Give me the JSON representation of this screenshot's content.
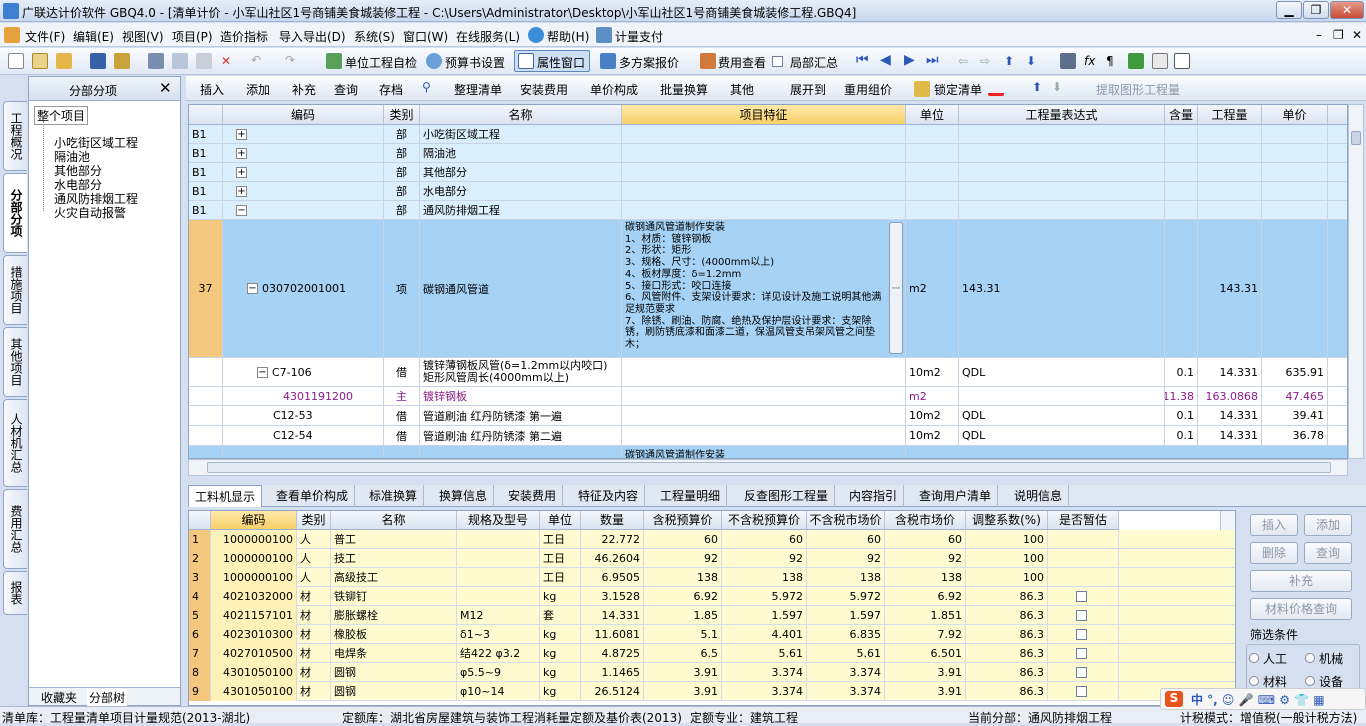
{
  "window": {
    "title": "广联达计价软件 GBQ4.0 - [清单计价 - 小军山社区1号商铺美食城装修工程 - C:\\Users\\Administrator\\Desktop\\小军山社区1号商铺美食城装修工程.GBQ4]"
  },
  "menu": [
    "文件(F)",
    "编辑(E)",
    "视图(V)",
    "项目(P)",
    "造价指标",
    "导入导出(D)",
    "系统(S)",
    "窗口(W)",
    "在线服务(L)",
    "帮助(H)",
    "计量支付"
  ],
  "toolbar1": {
    "self_check": "单位工程自检",
    "budget_settings": "预算书设置",
    "property_window": "属性窗口",
    "multi_plan": "多方案报价",
    "fee_view": "费用查看",
    "local_summary": "局部汇总"
  },
  "toolbar2": [
    "插入",
    "添加",
    "补充",
    "查询",
    "存档",
    "整理清单",
    "安装费用",
    "单价构成",
    "批量换算",
    "其他",
    "展开到",
    "重用组价",
    "锁定清单",
    "提取图形工程量"
  ],
  "left_panel": {
    "title": "分部分项",
    "root": "整个项目",
    "items": [
      "小吃街区域工程",
      "隔油池",
      "其他部分",
      "水电部分",
      "通风防排烟工程",
      "火灾自动报警"
    ],
    "tabs": [
      "收藏夹",
      "分部树"
    ]
  },
  "vertical_tabs": [
    "工程概况",
    "分部分项",
    "措施项目",
    "其他项目",
    "人材机汇总",
    "费用汇总",
    "报表"
  ],
  "top_grid": {
    "headers": [
      "编码",
      "类别",
      "名称",
      "项目特征",
      "单位",
      "工程量表达式",
      "含量",
      "工程量",
      "单价"
    ],
    "rows": [
      {
        "idx": "B1",
        "code": "",
        "type": "部",
        "name": "小吃街区域工程",
        "feature": "",
        "unit": "",
        "expr": "",
        "content": "",
        "qty": "",
        "price": ""
      },
      {
        "idx": "B1",
        "code": "",
        "type": "部",
        "name": "隔油池",
        "feature": "",
        "unit": "",
        "expr": "",
        "content": "",
        "qty": "",
        "price": ""
      },
      {
        "idx": "B1",
        "code": "",
        "type": "部",
        "name": "其他部分",
        "feature": "",
        "unit": "",
        "expr": "",
        "content": "",
        "qty": "",
        "price": ""
      },
      {
        "idx": "B1",
        "code": "",
        "type": "部",
        "name": "水电部分",
        "feature": "",
        "unit": "",
        "expr": "",
        "content": "",
        "qty": "",
        "price": ""
      },
      {
        "idx": "B1",
        "code": "",
        "type": "部",
        "name": "通风防排烟工程",
        "feature": "",
        "unit": "",
        "expr": "",
        "content": "",
        "qty": "",
        "price": ""
      },
      {
        "idx": "37",
        "code": "030702001001",
        "type": "项",
        "name": "碳钢通风管道",
        "feature": "碳钢通风管道制作安装\n1、材质：镀锌钢板\n2、形状：矩形\n3、规格、尺寸：(4000mm以上)\n4、板材厚度：δ=1.2mm\n5、接口形式：咬口连接\n6、风管附件、支架设计要求：详见设计及施工说明其他满足规范要求\n7、除锈、刷油、防腐、绝热及保护层设计要求：支架除锈，刷防锈底漆和面漆二道，保温风管支吊架风管之间垫木；",
        "unit": "m2",
        "expr": "143.31",
        "content": "",
        "qty": "143.31",
        "price": ""
      },
      {
        "idx": "",
        "code": "C7-106",
        "type": "借",
        "name": "镀锌薄钢板风管(δ=1.2mm以内咬口) 矩形风管周长(4000mm以上)",
        "feature": "",
        "unit": "10m2",
        "expr": "QDL",
        "content": "0.1",
        "qty": "14.331",
        "price": "635.91"
      },
      {
        "idx": "",
        "code": "4301191200",
        "type": "主",
        "name": "镀锌钢板",
        "feature": "",
        "unit": "m2",
        "expr": "",
        "content": "11.38",
        "qty": "163.0868",
        "price": "47.465"
      },
      {
        "idx": "",
        "code": "C12-53",
        "type": "借",
        "name": "管道刷油 红丹防锈漆 第一遍",
        "feature": "",
        "unit": "10m2",
        "expr": "QDL",
        "content": "0.1",
        "qty": "14.331",
        "price": "39.41"
      },
      {
        "idx": "",
        "code": "C12-54",
        "type": "借",
        "name": "管道刷油 红丹防锈漆 第二遍",
        "feature": "",
        "unit": "10m2",
        "expr": "QDL",
        "content": "0.1",
        "qty": "14.331",
        "price": "36.78"
      },
      {
        "idx": "",
        "code": "",
        "type": "",
        "name": "",
        "feature": "碳钢通风管道制作安装",
        "unit": "",
        "expr": "",
        "content": "",
        "qty": "",
        "price": ""
      }
    ]
  },
  "bottom_tabs": [
    "工料机显示",
    "查看单价构成",
    "标准换算",
    "换算信息",
    "安装费用",
    "特征及内容",
    "工程量明细",
    "反查图形工程量",
    "内容指引",
    "查询用户清单",
    "说明信息"
  ],
  "bottom_grid": {
    "headers": [
      "编码",
      "类别",
      "名称",
      "规格及型号",
      "单位",
      "数量",
      "含税预算价",
      "不含税预算价",
      "不含税市场价",
      "含税市场价",
      "调整系数(%)",
      "是否暂估"
    ],
    "rows": [
      {
        "n": "1",
        "code": "1000000100",
        "type": "人",
        "name": "普工",
        "spec": "",
        "unit": "工日",
        "qty": "22.772",
        "p1": "60",
        "p2": "60",
        "p3": "60",
        "p4": "60",
        "coef": "100",
        "chk": false
      },
      {
        "n": "2",
        "code": "1000000100",
        "type": "人",
        "name": "技工",
        "spec": "",
        "unit": "工日",
        "qty": "46.2604",
        "p1": "92",
        "p2": "92",
        "p3": "92",
        "p4": "92",
        "coef": "100",
        "chk": false
      },
      {
        "n": "3",
        "code": "1000000100",
        "type": "人",
        "name": "高级技工",
        "spec": "",
        "unit": "工日",
        "qty": "6.9505",
        "p1": "138",
        "p2": "138",
        "p3": "138",
        "p4": "138",
        "coef": "100",
        "chk": false
      },
      {
        "n": "4",
        "code": "4021032000",
        "type": "材",
        "name": "铁铆钉",
        "spec": "",
        "unit": "kg",
        "qty": "3.1528",
        "p1": "6.92",
        "p2": "5.972",
        "p3": "5.972",
        "p4": "6.92",
        "coef": "86.3",
        "chk": true
      },
      {
        "n": "5",
        "code": "4021157101",
        "type": "材",
        "name": "膨胀螺栓",
        "spec": "M12",
        "unit": "套",
        "qty": "14.331",
        "p1": "1.85",
        "p2": "1.597",
        "p3": "1.597",
        "p4": "1.851",
        "coef": "86.3",
        "chk": true
      },
      {
        "n": "6",
        "code": "4023010300",
        "type": "材",
        "name": "橡胶板",
        "spec": "δ1~3",
        "unit": "kg",
        "qty": "11.6081",
        "p1": "5.1",
        "p2": "4.401",
        "p3": "6.835",
        "p4": "7.92",
        "coef": "86.3",
        "chk": true
      },
      {
        "n": "7",
        "code": "4027010500",
        "type": "材",
        "name": "电焊条",
        "spec": "结422 φ3.2",
        "unit": "kg",
        "qty": "4.8725",
        "p1": "6.5",
        "p2": "5.61",
        "p3": "5.61",
        "p4": "6.501",
        "coef": "86.3",
        "chk": true
      },
      {
        "n": "8",
        "code": "4301050100",
        "type": "材",
        "name": "圆钢",
        "spec": "φ5.5~9",
        "unit": "kg",
        "qty": "1.1465",
        "p1": "3.91",
        "p2": "3.374",
        "p3": "3.374",
        "p4": "3.91",
        "coef": "86.3",
        "chk": true
      },
      {
        "n": "9",
        "code": "4301050100",
        "type": "材",
        "name": "圆钢",
        "spec": "φ10~14",
        "unit": "kg",
        "qty": "26.5124",
        "p1": "3.91",
        "p2": "3.374",
        "p3": "3.374",
        "p4": "3.91",
        "coef": "86.3",
        "chk": true
      }
    ]
  },
  "right_panel": {
    "insert": "插入",
    "add": "添加",
    "delete": "删除",
    "query": "查询",
    "supplement": "补充",
    "price_query": "材料价格查询",
    "filter_title": "筛选条件",
    "f_labor": "人工",
    "f_machine": "机械",
    "f_material": "材料",
    "f_equipment": "设备"
  },
  "status": {
    "list_lib": "清单库：工程量清单项目计量规范(2013-湖北)",
    "quota_lib": "定额库：湖北省房屋建筑与装饰工程消耗量定额及基价表(2013)",
    "specialty": "定额专业：建筑工程",
    "current": "当前分部：通风防排烟工程",
    "tax": "计税模式：增值税(一般计税方法)"
  },
  "colors": {
    "selected_row": "#a6d2f5",
    "feature_col": "#fff4c2",
    "row_idx_col": "#f3c77d",
    "bottom_yellow": "#fffbd0"
  }
}
